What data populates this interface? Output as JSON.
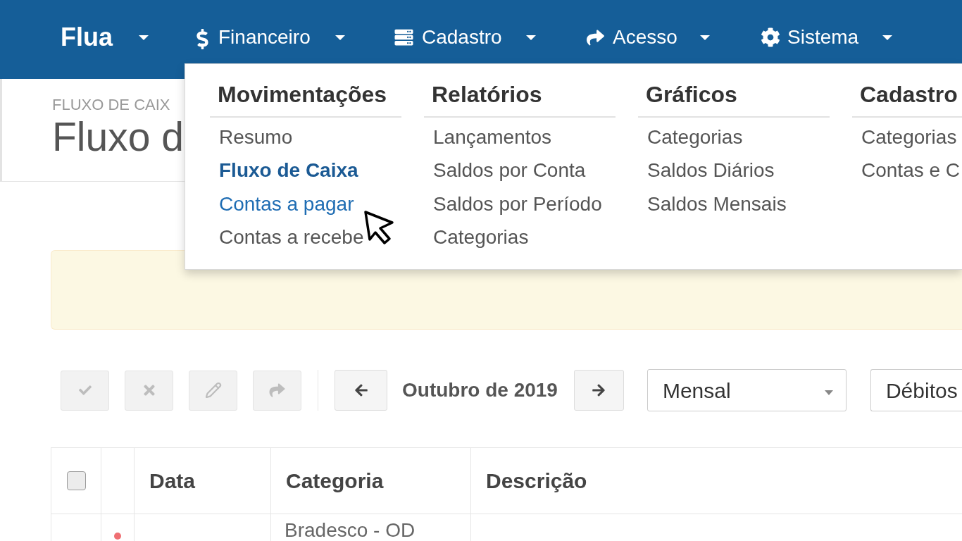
{
  "navbar": {
    "items": [
      {
        "kind": "brand",
        "label": "Flua"
      },
      {
        "kind": "menu",
        "label": "Financeiro"
      },
      {
        "kind": "menu",
        "label": "Cadastro"
      },
      {
        "kind": "menu",
        "label": "Acesso"
      },
      {
        "kind": "menu",
        "label": "Sistema"
      }
    ]
  },
  "page_header": {
    "breadcrumb": "FLUXO DE CAIX",
    "title": "Fluxo d"
  },
  "mega_menu": {
    "columns": [
      {
        "heading": "Movimentações",
        "items": [
          {
            "label": "Resumo",
            "selected": false,
            "hovered": false
          },
          {
            "label": "Fluxo de Caixa",
            "selected": true,
            "hovered": false
          },
          {
            "label": "Contas a pagar",
            "selected": false,
            "hovered": true
          },
          {
            "label": "Contas a recebe",
            "selected": false,
            "hovered": false
          }
        ]
      },
      {
        "heading": "Relatórios",
        "items": [
          {
            "label": "Lançamentos",
            "selected": false,
            "hovered": false
          },
          {
            "label": "Saldos por Conta",
            "selected": false,
            "hovered": false
          },
          {
            "label": "Saldos por Período",
            "selected": false,
            "hovered": false
          },
          {
            "label": "Categorias",
            "selected": false,
            "hovered": false
          }
        ]
      },
      {
        "heading": "Gráficos",
        "items": [
          {
            "label": "Categorias",
            "selected": false,
            "hovered": false
          },
          {
            "label": "Saldos Diários",
            "selected": false,
            "hovered": false
          },
          {
            "label": "Saldos Mensais",
            "selected": false,
            "hovered": false
          }
        ]
      },
      {
        "heading": "Cadastro",
        "items": [
          {
            "label": "Categorias",
            "selected": false,
            "hovered": false
          },
          {
            "label": "Contas e C",
            "selected": false,
            "hovered": false
          }
        ]
      }
    ]
  },
  "toolbar": {
    "actions": [
      {
        "disabled": true
      },
      {
        "disabled": true
      },
      {
        "disabled": true
      },
      {
        "disabled": true
      }
    ],
    "period": "Outubro de 2019",
    "filters": [
      {
        "value": "Mensal"
      },
      {
        "value": "Débitos"
      }
    ]
  },
  "table": {
    "columns": [
      {
        "kind": "checkbox",
        "checked": false
      },
      {
        "kind": "blank"
      },
      {
        "kind": "text",
        "label": "Data"
      },
      {
        "kind": "text",
        "label": "Categoria"
      },
      {
        "kind": "text",
        "label": "Descrição"
      }
    ],
    "rows": [
      {
        "color": "#ef6f73",
        "category": "Bradesco - OD"
      }
    ]
  }
}
